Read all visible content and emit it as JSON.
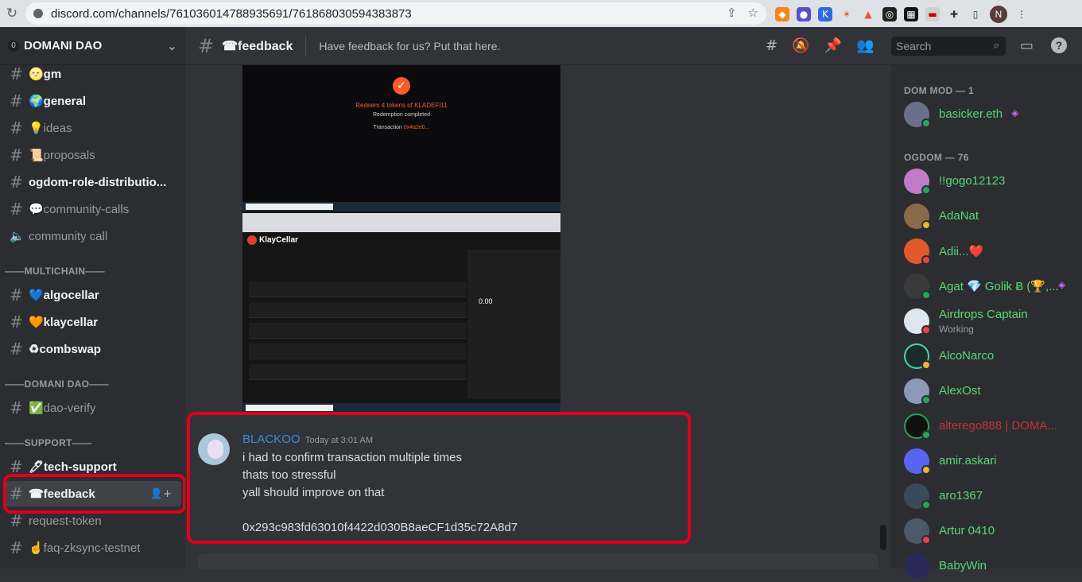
{
  "browser": {
    "url": "discord.com/channels/761036014788935691/761868030594383873",
    "profile_initial": "N"
  },
  "server": {
    "name": "DOMANI DAO",
    "badge": "0"
  },
  "channels": [
    {
      "label": "🌝gm"
    },
    {
      "label": "🌍general"
    },
    {
      "label": "💡ideas"
    },
    {
      "label": "📜proposals"
    },
    {
      "label": "ogdom-role-distributio..."
    },
    {
      "label": "💬community-calls"
    },
    {
      "label": "community call"
    }
  ],
  "categories": {
    "multichain": "——MULTICHAIN——",
    "domani": "——DOMANI DAO——",
    "support": "——SUPPORT——"
  },
  "multichain_channels": [
    {
      "label": "💙algocellar"
    },
    {
      "label": "🧡klaycellar"
    },
    {
      "label": "♻combswap"
    }
  ],
  "domani_channels": [
    {
      "label": "✅dao-verify"
    }
  ],
  "support_channels": [
    {
      "label": "🖊tech-support"
    },
    {
      "label": "☎feedback"
    },
    {
      "label": "request-token"
    },
    {
      "label": "☝faq-zksync-testnet"
    }
  ],
  "header": {
    "channel_title": "☎feedback",
    "topic": "Have feedback for us? Put that here.",
    "search_placeholder": "Search"
  },
  "attachment": {
    "redeem_title": "Redeem 4 tokens of KLADEFI11",
    "redeem_status": "Redemption completed",
    "transaction_label": "Transaction",
    "transaction_hash": "0x4a2e0..."
  },
  "message": {
    "author": "BLACKOO",
    "timestamp": "Today at 3:01 AM",
    "lines": [
      "i had to confirm transaction multiple times",
      "thats too stressful",
      "yall should improve on that",
      "",
      "0x293c983fd63010f4422d030B8aeCF1d35c72A8d7"
    ]
  },
  "members": {
    "mod_header": "DOM MOD — 1",
    "ogdom_header": "OGDOM — 76",
    "list": [
      {
        "name": "basicker.eth",
        "color": "#57d973"
      },
      {
        "name": "!!gogo12123",
        "color": "#57d973"
      },
      {
        "name": "AdaNat",
        "color": "#57d973"
      },
      {
        "name": "Adii...❤️",
        "color": "#57d973"
      },
      {
        "name": "Agat 💎 Golik Ƀ (🏆,...",
        "color": "#57d973"
      },
      {
        "name": "Airdrops Captain",
        "status": "Working",
        "color": "#57d973"
      },
      {
        "name": "AlcoNarco",
        "color": "#57d973"
      },
      {
        "name": "AlexOst",
        "color": "#57d973"
      },
      {
        "name": "alterego888 | DOMA...",
        "color": "#c4313a"
      },
      {
        "name": "amir.askari",
        "color": "#57d973"
      },
      {
        "name": "aro1367",
        "color": "#57d973"
      },
      {
        "name": "Artur 0410",
        "color": "#57d973"
      },
      {
        "name": "BabyWin",
        "color": "#57d973"
      }
    ]
  },
  "colors": {
    "highlight": "#e0001b",
    "online": "#23a55a",
    "dnd": "#f23f43",
    "idle": "#f0b232"
  }
}
